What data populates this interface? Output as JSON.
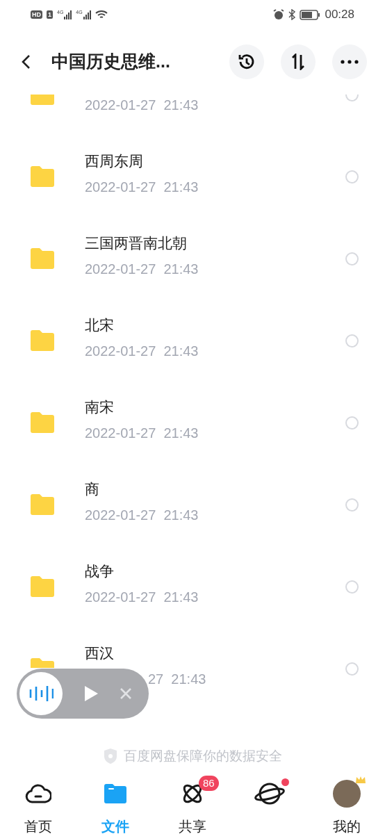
{
  "status_bar": {
    "hd": "HD",
    "sim": "1",
    "networks": [
      "4G",
      "4G"
    ],
    "time": "00:28"
  },
  "header": {
    "title": "中国历史思维..."
  },
  "files": [
    {
      "kind": "clipped",
      "date": "2022-01-27  21:43",
      "selected": false
    },
    {
      "kind": "full",
      "name": "西周东周",
      "date": "2022-01-27  21:43",
      "selected": false
    },
    {
      "kind": "full",
      "name": "三国两晋南北朝",
      "date": "2022-01-27  21:43",
      "selected": false
    },
    {
      "kind": "full",
      "name": "北宋",
      "date": "2022-01-27  21:43",
      "selected": false
    },
    {
      "kind": "full",
      "name": "南宋",
      "date": "2022-01-27  21:43",
      "selected": false
    },
    {
      "kind": "full",
      "name": "商",
      "date": "2022-01-27  21:43",
      "selected": false
    },
    {
      "kind": "full",
      "name": "战争",
      "date": "2022-01-27  21:43",
      "selected": false
    },
    {
      "kind": "covered",
      "name": "西汉",
      "date": "27  21:43",
      "selected": false
    }
  ],
  "security_note": "百度网盘保障你的数据安全",
  "tabs": [
    {
      "kind": "home",
      "label": "首页",
      "selected": false
    },
    {
      "kind": "files",
      "label": "文件",
      "selected": true
    },
    {
      "kind": "share",
      "label": "共享",
      "selected": false,
      "badge": "86"
    },
    {
      "kind": "planet",
      "selected": false,
      "dot": true
    },
    {
      "kind": "me",
      "label": "我的",
      "selected": false
    }
  ]
}
